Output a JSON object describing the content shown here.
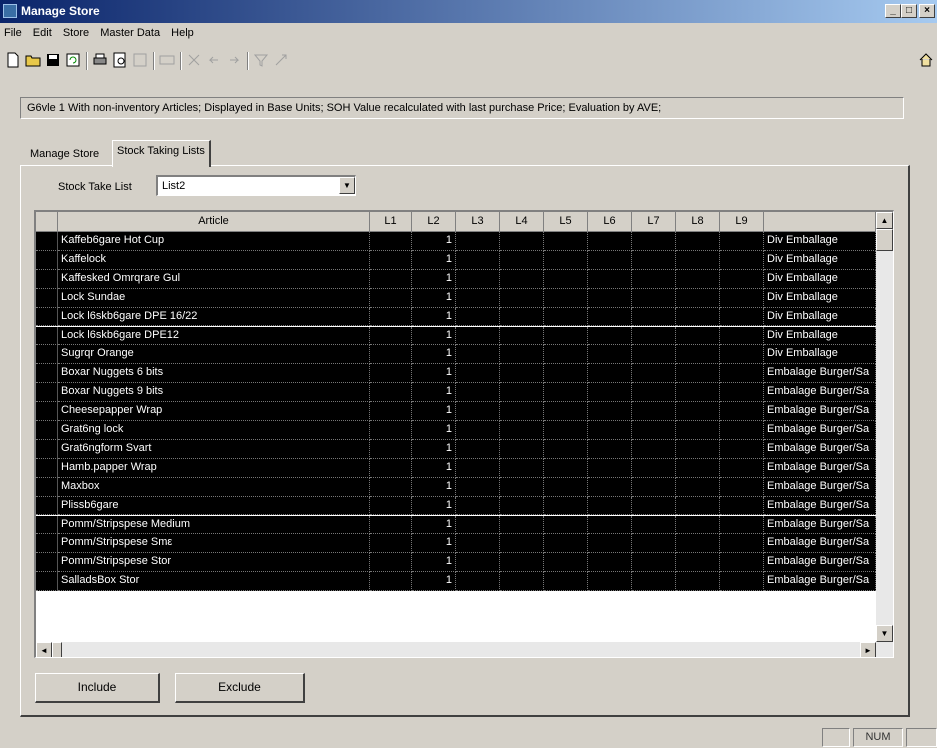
{
  "window": {
    "title": "Manage Store",
    "min_label": "_",
    "max_label": "□",
    "close_label": "×"
  },
  "menu": [
    "File",
    "Edit",
    "Store",
    "Master Data",
    "Help"
  ],
  "toolbar": {
    "icons": [
      "new-icon",
      "open-icon",
      "save-icon",
      "refresh-icon",
      "print-icon",
      "print-preview-icon",
      "export-icon",
      "info-icon",
      "delete-icon",
      "back-icon",
      "forward-icon",
      "filter-icon",
      "calculate-icon",
      "home-icon"
    ]
  },
  "info_text": "G6vle 1 With non-inventory Articles; Displayed in Base Units; SOH Value recalculated with last purchase Price; Evaluation by AVE;",
  "tabs": [
    "Manage Store",
    "Stock Taking Lists"
  ],
  "active_tab": 1,
  "stock_take_list": {
    "label": "Stock Take List",
    "value": "List2",
    "dropdown_glyph": "▼"
  },
  "grid": {
    "columns": [
      "Article",
      "L1",
      "L2",
      "L3",
      "L4",
      "L5",
      "L6",
      "L7",
      "L8",
      "L9",
      ""
    ],
    "rows": [
      {
        "article": "Kaffeb6gare Hot Cup",
        "l2": "1",
        "category": "Div Emballage"
      },
      {
        "article": "Kaffelock",
        "l2": "1",
        "category": "Div Emballage"
      },
      {
        "article": "Kaffesked Omrqrare Gul",
        "l2": "1",
        "category": "Div Emballage"
      },
      {
        "article": "Lock Sundae",
        "l2": "1",
        "category": "Div Emballage"
      },
      {
        "article": "Lock l6skb6gare DPE 16/22",
        "l2": "1",
        "category": "Div Emballage"
      },
      {
        "article": "Lock l6skb6gare DPE12",
        "l2": "1",
        "category": "Div Emballage"
      },
      {
        "article": "Sugrqr Orange",
        "l2": "1",
        "category": "Div Emballage"
      },
      {
        "article": "Boxar Nuggets 6 bits",
        "l2": "1",
        "category": "Embalage Burger/Sa"
      },
      {
        "article": "Boxar Nuggets 9 bits",
        "l2": "1",
        "category": "Embalage Burger/Sa"
      },
      {
        "article": "Cheesepapper Wrap",
        "l2": "1",
        "category": "Embalage Burger/Sa"
      },
      {
        "article": "Grat6ng lock",
        "l2": "1",
        "category": "Embalage Burger/Sa"
      },
      {
        "article": "Grat6ngform Svart",
        "l2": "1",
        "category": "Embalage Burger/Sa"
      },
      {
        "article": "Hamb.papper  Wrap",
        "l2": "1",
        "category": "Embalage Burger/Sa"
      },
      {
        "article": "Maxbox",
        "l2": "1",
        "category": "Embalage Burger/Sa"
      },
      {
        "article": "Plissb6gare",
        "l2": "1",
        "category": "Embalage Burger/Sa"
      },
      {
        "article": "Pomm/Stripspese Medium",
        "l2": "1",
        "category": "Embalage Burger/Sa"
      },
      {
        "article": "Pomm/Stripspese Smε",
        "l2": "1",
        "category": "Embalage Burger/Sa"
      },
      {
        "article": "Pomm/Stripspese Stor",
        "l2": "1",
        "category": "Embalage Burger/Sa"
      },
      {
        "article": "SalladsBox Stor",
        "l2": "1",
        "category": "Embalage Burger/Sa"
      }
    ],
    "scroll_up": "▲",
    "scroll_down": "▼",
    "scroll_left": "◄",
    "scroll_right": "►"
  },
  "buttons": {
    "include": "Include",
    "exclude": "Exclude"
  },
  "status": {
    "num": "NUM"
  }
}
